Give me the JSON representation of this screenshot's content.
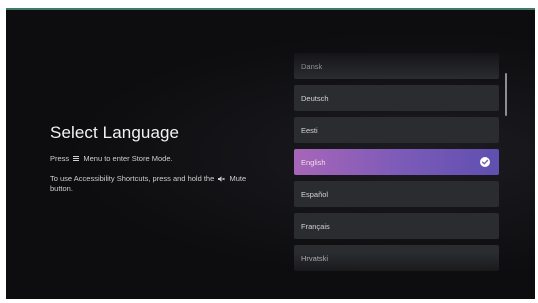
{
  "screen": {
    "title": "Select Language",
    "hint_store_before": "Press",
    "hint_store_after": "Menu to enter Store Mode.",
    "hint_access_before": "To use Accessibility Shortcuts, press and hold the",
    "hint_access_after": "Mute button."
  },
  "languages": [
    {
      "label": "Dansk",
      "selected": false
    },
    {
      "label": "Deutsch",
      "selected": false
    },
    {
      "label": "Eesti",
      "selected": false
    },
    {
      "label": "English",
      "selected": true
    },
    {
      "label": "Español",
      "selected": false
    },
    {
      "label": "Français",
      "selected": false
    },
    {
      "label": "Hrvatski",
      "selected": false
    }
  ],
  "icons": {
    "menu": "menu-icon",
    "mute": "mute-icon",
    "selected": "checkmark-icon"
  },
  "colors": {
    "background": "#0d0d0f",
    "item": "#2b2c30",
    "selected_start": "#a766b8",
    "selected_end": "#5f4fb0",
    "check": "#ffffff"
  }
}
